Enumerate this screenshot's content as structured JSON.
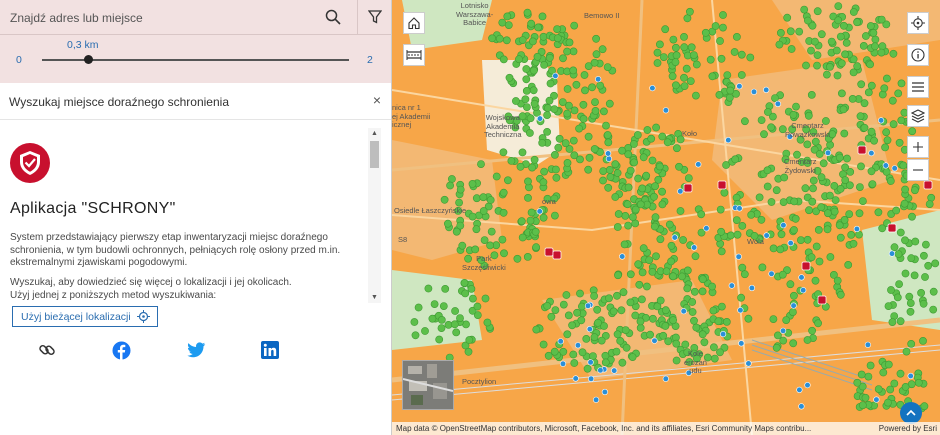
{
  "search": {
    "placeholder": "Znajdź adres lub miejsce",
    "search_icon": "search-icon",
    "filter_icon": "filter-icon"
  },
  "slider": {
    "current": "0,3 km",
    "min": "0",
    "max": "2",
    "position_fraction": 0.15
  },
  "panel": {
    "title": "Wyszukaj miejsce doraźnego schronienia",
    "close": "×",
    "app_title": "Aplikacja \"SCHRONY\"",
    "description": "System przedstawiający pierwszy etap inwentaryzacji miejsc doraźnego schronienia, w tym budowli ochronnych, pełniących rolę osłony przed m.in. ekstremalnymi zjawiskami pogodowymi.",
    "instructions_1": "Wyszukaj, aby dowiedzieć się więcej o lokalizacji i jej okolicach.",
    "instructions_2": "Użyj jednej z poniższych metod wyszukiwania:",
    "use_location_button": "Użyj bieżącej lokalizacji"
  },
  "social": [
    "link-icon",
    "facebook-icon",
    "twitter-icon",
    "linkedin-icon"
  ],
  "map": {
    "labels": {
      "wojskowa": "Wojskowa\nAkademia\nTechniczna",
      "cmentarz_pow": "Cmentarz\nPowązkowski",
      "cmentarz_zyd": "Cmentarz\nŻydowski",
      "lotnisko": "Lotnisko\nWarszawa-\nBabice",
      "wola": "Wola",
      "kole": "Koło",
      "park": "Park\nSzczęśliwicki",
      "akademii": "nica nr 1\nej Akademii\nicznej",
      "bemowo": "Bemowo II",
      "leszczynskie": "Osiedle Łaszczyńskie",
      "cmentarz_short": "Cmentarz",
      "zydowski_short": "żydowski",
      "s8": "S8",
      "pocztylion": "Pocztylion",
      "kolejowa": "Kole\nerozań\nudu",
      "owa": "owa"
    },
    "attribution": "Map data © OpenStreetMap contributors, Microsoft, Facebook, Inc. and its affiliates, Esri Community Maps contribu...",
    "powered_by": "Powered by Esri",
    "colors": {
      "urban": "#f7a648",
      "green": "#7ccf6b",
      "pin_green": "#5cbf4a",
      "pin_red": "#c8102e",
      "pin_blue": "#2a8fd8"
    }
  },
  "map_controls": [
    "home-icon",
    "measure-icon",
    "locate-icon",
    "info-icon",
    "list-icon",
    "layers-icon",
    "zoom-in-icon",
    "zoom-out-icon"
  ]
}
